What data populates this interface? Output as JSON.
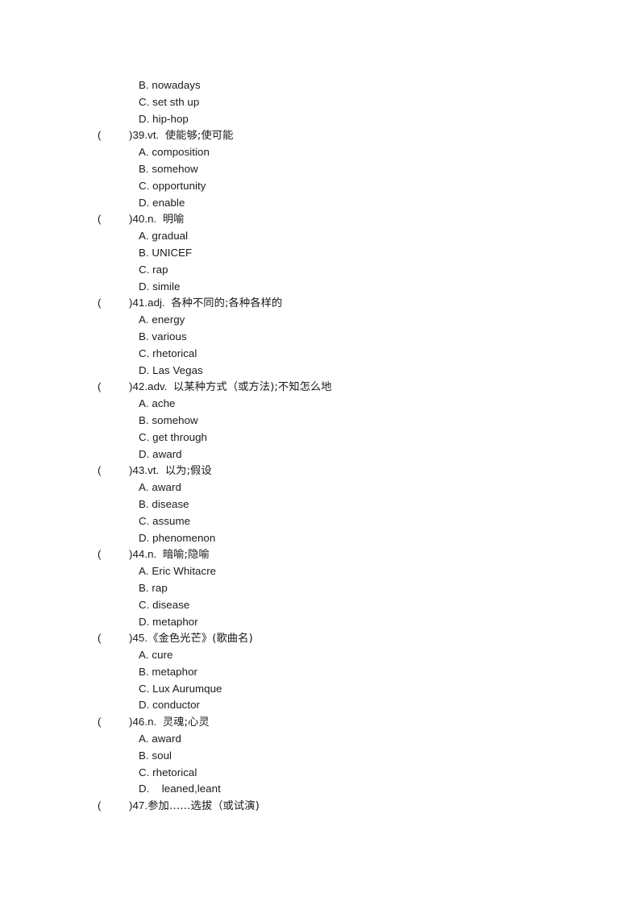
{
  "document": {
    "type": "vocabulary-multiple-choice-worksheet",
    "language_mix": "english-chinese",
    "text_color": "#1a1a1a",
    "background_color": "#ffffff"
  },
  "orphan_options": [
    {
      "letter": "B.",
      "text": "nowadays"
    },
    {
      "letter": "C.",
      "text": "set sth up"
    },
    {
      "letter": "D.",
      "text": "hip-hop"
    }
  ],
  "questions": [
    {
      "paren_open": "(",
      "paren_close": ")",
      "number": "39.",
      "pos": "vt.",
      "prompt": "使能够;使可能",
      "options": [
        {
          "letter": "A.",
          "text": "composition"
        },
        {
          "letter": "B.",
          "text": "somehow"
        },
        {
          "letter": "C.",
          "text": "opportunity"
        },
        {
          "letter": "D.",
          "text": "enable"
        }
      ]
    },
    {
      "paren_open": "(",
      "paren_close": ")",
      "number": "40.",
      "pos": "n.",
      "prompt": "明喻",
      "options": [
        {
          "letter": "A.",
          "text": "gradual"
        },
        {
          "letter": "B.",
          "text": "UNICEF"
        },
        {
          "letter": "C.",
          "text": "rap"
        },
        {
          "letter": "D.",
          "text": "simile"
        }
      ]
    },
    {
      "paren_open": "(",
      "paren_close": ")",
      "number": "41.",
      "pos": "adj.",
      "prompt": "各种不同的;各种各样的",
      "options": [
        {
          "letter": "A.",
          "text": "energy"
        },
        {
          "letter": "B.",
          "text": "various"
        },
        {
          "letter": "C.",
          "text": "rhetorical"
        },
        {
          "letter": "D.",
          "text": "Las Vegas"
        }
      ]
    },
    {
      "paren_open": "(",
      "paren_close": ")",
      "number": "42.",
      "pos": "adv.",
      "prompt": "以某种方式（或方法);不知怎么地",
      "options": [
        {
          "letter": "A.",
          "text": "ache"
        },
        {
          "letter": "B.",
          "text": "somehow"
        },
        {
          "letter": "C.",
          "text": "get through"
        },
        {
          "letter": "D.",
          "text": "award"
        }
      ]
    },
    {
      "paren_open": "(",
      "paren_close": ")",
      "number": "43.",
      "pos": "vt.",
      "prompt": "以为;假设",
      "options": [
        {
          "letter": "A.",
          "text": "award"
        },
        {
          "letter": "B.",
          "text": "disease"
        },
        {
          "letter": "C.",
          "text": "assume"
        },
        {
          "letter": "D.",
          "text": "phenomenon"
        }
      ]
    },
    {
      "paren_open": "(",
      "paren_close": ")",
      "number": "44.",
      "pos": "n.",
      "prompt": "暗喻;隐喻",
      "options": [
        {
          "letter": "A.",
          "text": "Eric Whitacre"
        },
        {
          "letter": "B.",
          "text": "rap"
        },
        {
          "letter": "C.",
          "text": "disease"
        },
        {
          "letter": "D.",
          "text": "metaphor"
        }
      ]
    },
    {
      "paren_open": "(",
      "paren_close": ")",
      "number": "45.",
      "pos": "",
      "prompt": "《金色光芒》(歌曲名)",
      "options": [
        {
          "letter": "A.",
          "text": "cure"
        },
        {
          "letter": "B.",
          "text": "metaphor"
        },
        {
          "letter": "C.",
          "text": "Lux Aurumque"
        },
        {
          "letter": "D.",
          "text": "conductor"
        }
      ]
    },
    {
      "paren_open": "(",
      "paren_close": ")",
      "number": "46.",
      "pos": "n.",
      "prompt": "灵魂;心灵",
      "options": [
        {
          "letter": "A.",
          "text": "award"
        },
        {
          "letter": "B.",
          "text": "soul"
        },
        {
          "letter": "C.",
          "text": "rhetorical"
        },
        {
          "letter": "D.",
          "text": "leaned,leant",
          "wide_gap": true
        }
      ]
    },
    {
      "paren_open": "(",
      "paren_close": ")",
      "number": "47.",
      "pos": "",
      "prompt": "参加……选拔（或试演)",
      "options": []
    }
  ]
}
